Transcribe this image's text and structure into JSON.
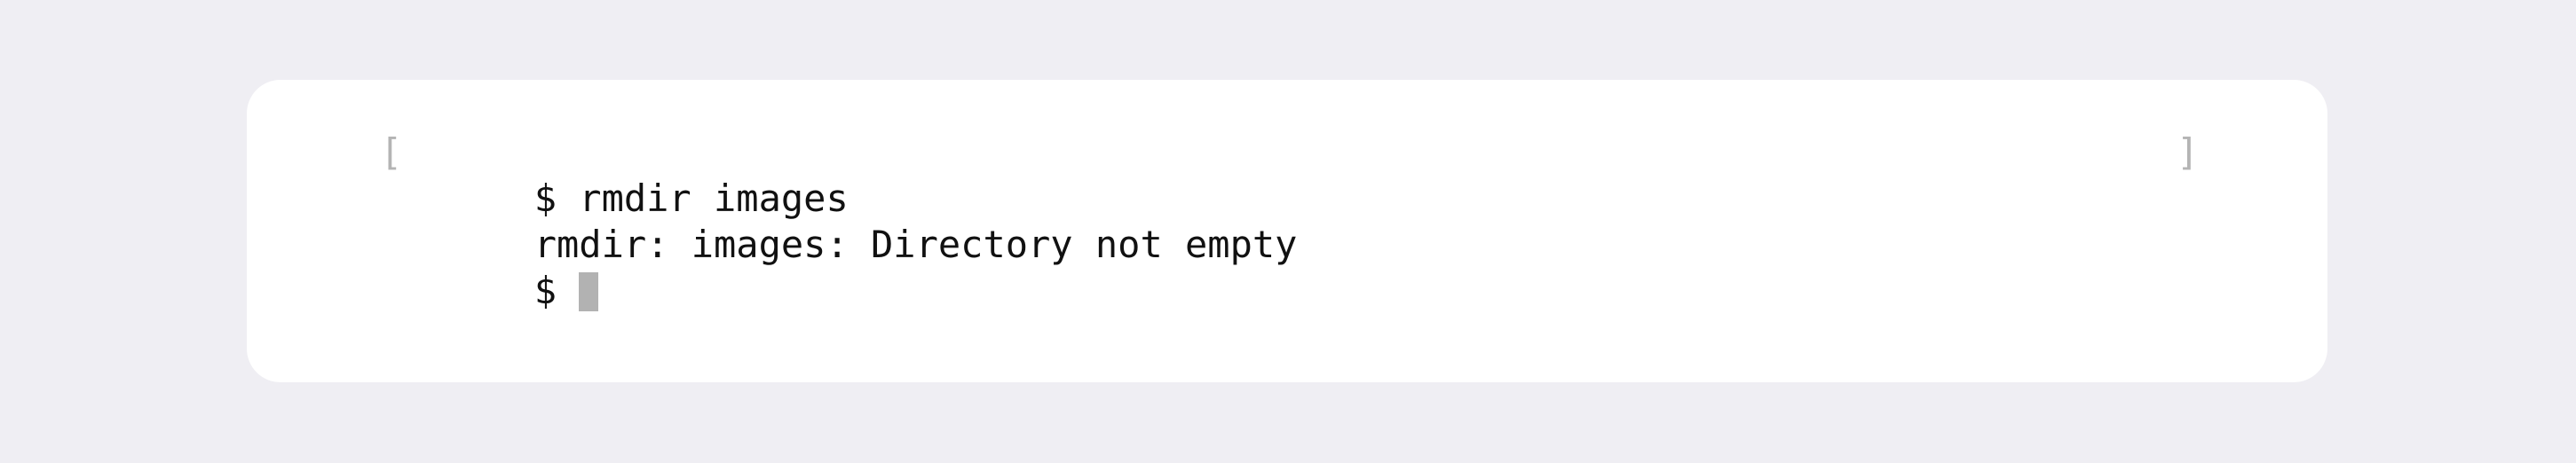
{
  "terminal": {
    "left_bracket": "[",
    "right_bracket": "]",
    "lines": [
      "$ rmdir images",
      "rmdir: images: Directory not empty",
      "$ "
    ]
  },
  "colors": {
    "background": "#efeef3",
    "card": "#ffffff",
    "text": "#111111",
    "bracket": "#b4b4b4",
    "cursor": "#b2b2b2"
  }
}
